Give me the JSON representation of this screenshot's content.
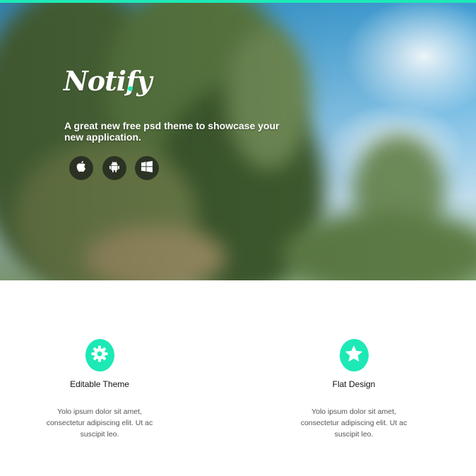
{
  "hero": {
    "logo": "Notify",
    "tagline": "A great new free psd theme to showcase your new application.",
    "platforms": [
      {
        "icon": "apple-icon"
      },
      {
        "icon": "android-icon"
      },
      {
        "icon": "windows-icon"
      }
    ]
  },
  "features": [
    {
      "icon": "gear-icon",
      "title": "Editable Theme",
      "description": "Yolo ipsum dolor sit amet, consectetur adipiscing elit. Ut ac suscipit leo."
    },
    {
      "icon": "star-icon",
      "title": "Flat Design",
      "description": "Yolo ipsum dolor sit amet, consectetur adipiscing elit. Ut ac suscipit leo."
    }
  ],
  "colors": {
    "accent": "#1de9b6",
    "text": "#111111",
    "muted": "#555555"
  }
}
